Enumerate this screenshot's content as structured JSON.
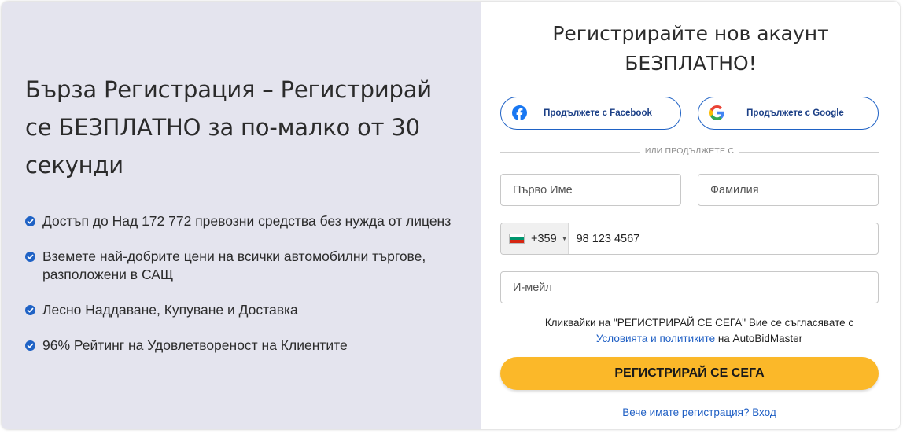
{
  "promo": {
    "headline": "Бърза Регистрация – Регистрирай се БЕЗПЛАТНО за по-малко от 30 секунди",
    "benefits": [
      "Достъп до Над 172 772 превозни средства без нужда от лиценз",
      "Вземете най-добрите цени на всички автомобилни търгове, разположени в САЩ",
      "Лесно Наддаване, Купуване и Доставка",
      "96% Рейтинг на Удовлетвореност на Клиентите"
    ],
    "check_icon": "check-circle-icon"
  },
  "form": {
    "title_line1": "Регистрирайте нов акаунт",
    "title_line2": "БЕЗПЛАТНО!",
    "facebook_label": "Продължете с Facebook",
    "google_label": "Продължете с Google",
    "divider_text": "ИЛИ ПРОДЪЛЖЕТЕ С",
    "first_name_placeholder": "Първо Име",
    "last_name_placeholder": "Фамилия",
    "phone_country_code": "+359",
    "phone_country_flag": "bulgaria-flag-icon",
    "phone_value": "98 123 4567",
    "email_placeholder": "И-мейл",
    "terms_prefix": "Кликвайки на \"РЕГИСТРИРАЙ СЕ СЕГА\" Вие се съгласявате с",
    "terms_link": "Условията и политиките",
    "terms_suffix": " на AutoBidMaster",
    "register_button": "РЕГИСТРИРАЙ СЕ СЕГА",
    "login_link": "Вече имате регистрация? Вход"
  },
  "colors": {
    "left_panel_bg": "#e4e4ee",
    "accent_blue": "#1f62c5",
    "register_button": "#fbb829",
    "link": "#1f5fc4"
  }
}
